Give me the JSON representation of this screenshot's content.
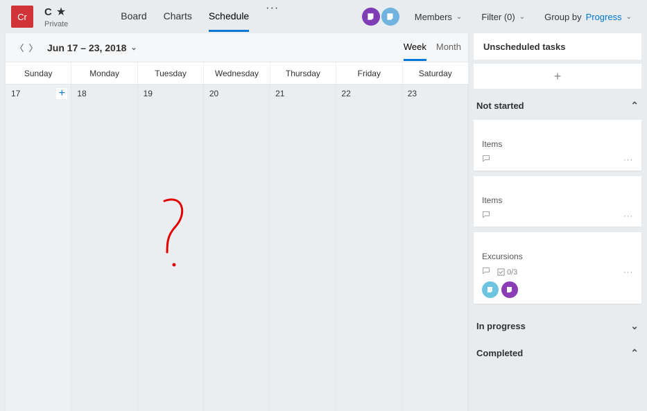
{
  "header": {
    "plan_icon_text": "Cr",
    "plan_title": "C",
    "privacy": "Private",
    "tabs": {
      "board": "Board",
      "charts": "Charts",
      "schedule": "Schedule",
      "more": "···"
    },
    "controls": {
      "members": "Members",
      "filter_label": "Filter (0)",
      "groupby_prefix": "Group by",
      "groupby_value": "Progress"
    }
  },
  "calendar": {
    "date_range": "Jun 17 – 23, 2018",
    "views": {
      "week": "Week",
      "month": "Month"
    },
    "weekdays": [
      "Sunday",
      "Monday",
      "Tuesday",
      "Wednesday",
      "Thursday",
      "Friday",
      "Saturday"
    ],
    "days": [
      "17",
      "18",
      "19",
      "20",
      "21",
      "22",
      "23"
    ]
  },
  "side": {
    "unscheduled": "Unscheduled tasks",
    "buckets": {
      "not_started": "Not started",
      "in_progress": "In progress",
      "completed": "Completed"
    },
    "tasks": [
      {
        "title": "",
        "bucket": "Items",
        "checklist": ""
      },
      {
        "title": "",
        "bucket": "Items",
        "checklist": ""
      },
      {
        "title": "",
        "bucket": "Excursions",
        "checklist": "0/3"
      }
    ]
  }
}
